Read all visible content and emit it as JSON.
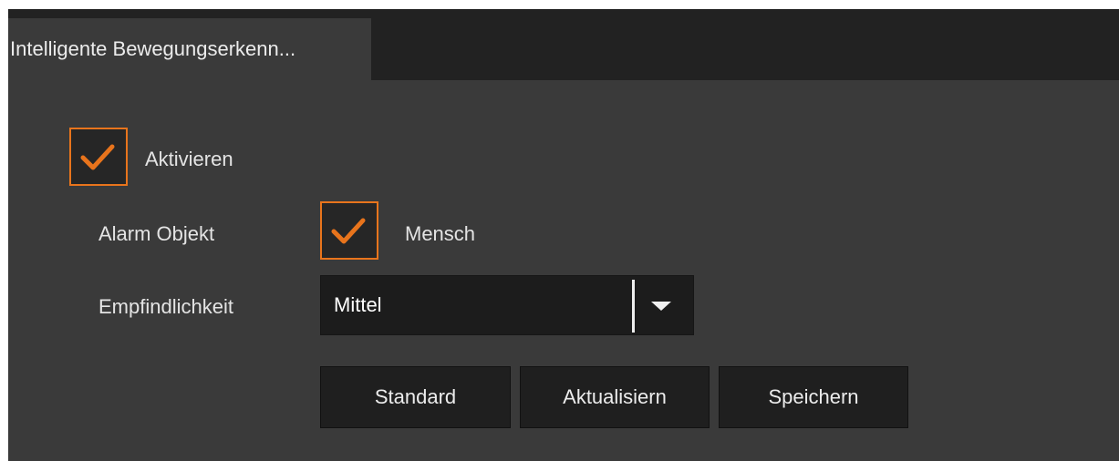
{
  "tab": {
    "label": "Intelligente Bewegungserkenn..."
  },
  "enable": {
    "label": "Aktivieren",
    "checked": true
  },
  "alarm_object": {
    "label": "Alarm Objekt",
    "option_label": "Mensch",
    "checked": true
  },
  "sensitivity": {
    "label": "Empfindlichkeit",
    "value": "Mittel"
  },
  "buttons": {
    "default_label": "Standard",
    "refresh_label": "Aktualisiern",
    "save_label": "Speichern"
  },
  "colors": {
    "accent": "#e8741c",
    "panel": "#3a3a3a",
    "tab_bar": "#222222",
    "control": "#1f1f1f"
  },
  "icons": {
    "checkmark": "checkmark-icon",
    "dropdown": "chevron-down-icon"
  }
}
